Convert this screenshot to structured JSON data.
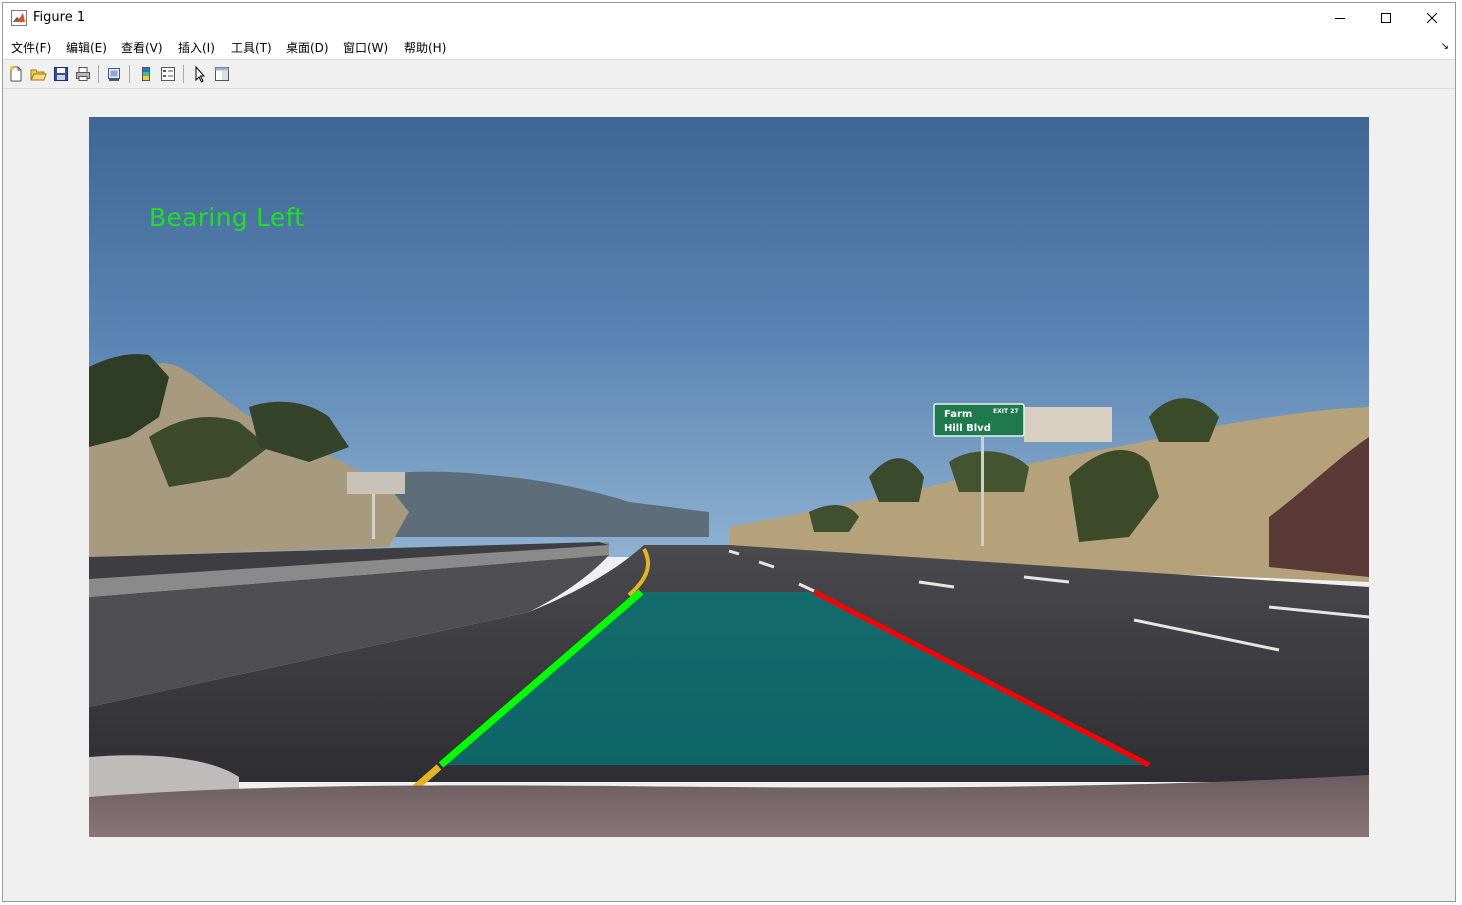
{
  "window": {
    "title": "Figure 1",
    "controls": {
      "minimize": "minimize-icon",
      "maximize": "maximize-icon",
      "close": "close-icon"
    }
  },
  "menu": {
    "items": [
      {
        "label": "文件(F)"
      },
      {
        "label": "编辑(E)"
      },
      {
        "label": "查看(V)"
      },
      {
        "label": "插入(I)"
      },
      {
        "label": "工具(T)"
      },
      {
        "label": "桌面(D)"
      },
      {
        "label": "窗口(W)"
      },
      {
        "label": "帮助(H)"
      }
    ],
    "dock_arrow": "↘"
  },
  "toolbar": {
    "icons": [
      "new-figure-icon",
      "open-file-icon",
      "save-icon",
      "print-icon",
      "link-plot-icon",
      "insert-colorbar-icon",
      "insert-legend-icon",
      "edit-plot-icon",
      "property-inspector-icon"
    ]
  },
  "figure": {
    "overlay_text": "Bearing Left",
    "sign_line1": "Farm",
    "sign_line2": "Hill Blvd",
    "sign_exit": "EXIT 27",
    "colors": {
      "overlay_text": "#1fe01f",
      "left_lane_line": "#00ff00",
      "right_lane_line": "#ff0000",
      "lane_fill": "#007a7a"
    }
  }
}
